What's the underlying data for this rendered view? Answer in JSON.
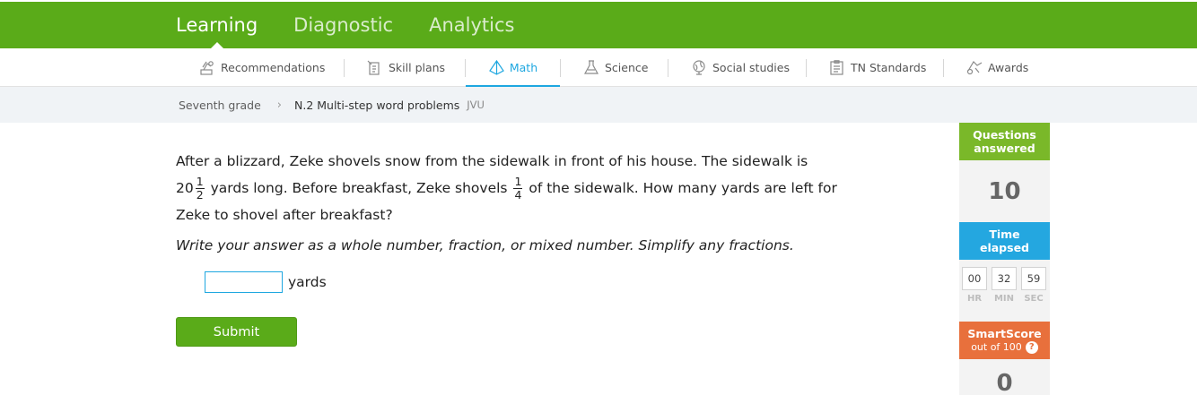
{
  "topnav": {
    "tabs": [
      {
        "label": "Learning"
      },
      {
        "label": "Diagnostic"
      },
      {
        "label": "Analytics"
      }
    ]
  },
  "subnav": {
    "items": [
      {
        "label": "Recommendations",
        "icon": "recommendations-icon"
      },
      {
        "label": "Skill plans",
        "icon": "skill-plans-icon"
      },
      {
        "label": "Math",
        "icon": "math-pyramid-icon"
      },
      {
        "label": "Science",
        "icon": "science-flask-icon"
      },
      {
        "label": "Social studies",
        "icon": "globe-icon"
      },
      {
        "label": "TN Standards",
        "icon": "standards-clipboard-icon"
      },
      {
        "label": "Awards",
        "icon": "awards-icon"
      }
    ]
  },
  "breadcrumb": {
    "grade": "Seventh grade",
    "skill": "N.2 Multi-step word problems",
    "code": "JVU"
  },
  "question": {
    "line1": "After a blizzard, Zeke shovels snow from the sidewalk in front of his house. The sidewalk is",
    "whole": "20",
    "frac1_num": "1",
    "frac1_den": "2",
    "mid": "yards long. Before breakfast, Zeke shovels",
    "frac2_num": "1",
    "frac2_den": "4",
    "end": "of the sidewalk. How many yards are left for Zeke to shovel after breakfast?",
    "instructions": "Write your answer as a whole number, fraction, or mixed number. Simplify any fractions.",
    "answer_value": "",
    "unit": "yards",
    "submit_label": "Submit"
  },
  "sidebar": {
    "answered_label": "Questions answered",
    "answered_count": "10",
    "time_label": "Time elapsed",
    "hr": "00",
    "min": "32",
    "sec": "59",
    "hr_label": "HR",
    "min_label": "MIN",
    "sec_label": "SEC",
    "smartscore_label": "SmartScore",
    "smartscore_sub": "out of 100",
    "help": "?",
    "smartscore_value": "0"
  },
  "colors": {
    "brand_green": "#5aab19",
    "accent_blue": "#1ea7e0",
    "smartscore_orange": "#e8703c"
  }
}
